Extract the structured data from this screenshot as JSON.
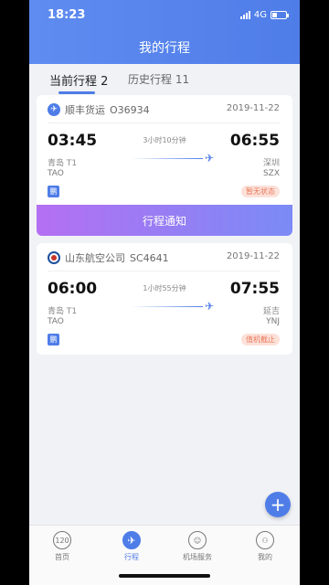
{
  "status_bar": {
    "time": "18:23",
    "network": "4G"
  },
  "header": {
    "title": "我的行程"
  },
  "tabs": [
    {
      "label": "当前行程 2",
      "active": true
    },
    {
      "label": "历史行程 11",
      "active": false
    }
  ],
  "trips": [
    {
      "airline": "顺丰货运",
      "flight_no": "O36934",
      "date": "2019-11-22",
      "dep_time": "03:45",
      "arr_time": "06:55",
      "duration": "3小时10分钟",
      "dep_city": "青岛 T1",
      "arr_city": "深圳",
      "dep_code": "TAO",
      "arr_code": "SZX",
      "badge": "鹏",
      "status": "暂无状态"
    },
    {
      "airline": "山东航空公司",
      "flight_no": "SC4641",
      "date": "2019-11-22",
      "dep_time": "06:00",
      "arr_time": "07:55",
      "duration": "1小时55分钟",
      "dep_city": "青岛 T1",
      "arr_city": "延吉",
      "dep_code": "TAO",
      "arr_code": "YNJ",
      "badge": "鹏",
      "status": "值机截止"
    }
  ],
  "notice_button": "行程通知",
  "fab": "+",
  "tabbar": [
    {
      "label": "首页",
      "icon": "120"
    },
    {
      "label": "行程",
      "icon": "✈"
    },
    {
      "label": "机场服务",
      "icon": "☺"
    },
    {
      "label": "我的",
      "icon": "⚇"
    }
  ],
  "colors": {
    "primary": "#4f7de8",
    "status_pill": "#e97a5c"
  }
}
